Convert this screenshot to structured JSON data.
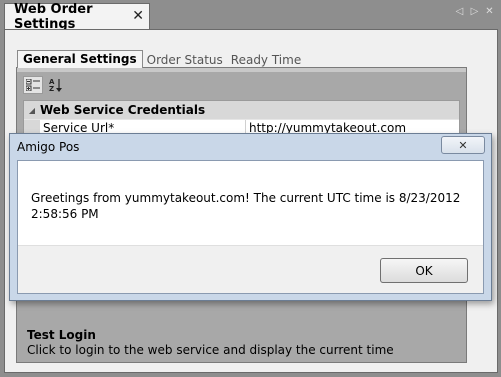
{
  "document": {
    "tab_title": "Web Order Settings",
    "close_glyph": "✕"
  },
  "inner_tabs": [
    {
      "label": "General Settings",
      "active": true
    },
    {
      "label": "Order Status",
      "active": false
    },
    {
      "label": "Ready Time",
      "active": false
    }
  ],
  "property_grid": {
    "toolbar": {
      "categorized_icon": "categorized-icon",
      "alphabetical_icon": "sort-az-icon"
    },
    "category": {
      "label": "Web Service Credentials",
      "expander": "◢"
    },
    "rows": [
      {
        "name": "Service Url*",
        "value": "http://yummytakeout.com"
      }
    ],
    "description": {
      "title": "Test Login",
      "text": "Click to login to the web service and display the current time"
    }
  },
  "dialog": {
    "title": "Amigo Pos",
    "close_glyph": "✕",
    "message": "Greetings from yummytakeout.com! The current UTC time is 8/23/2012 2:58:56 PM",
    "ok_label": "OK"
  }
}
